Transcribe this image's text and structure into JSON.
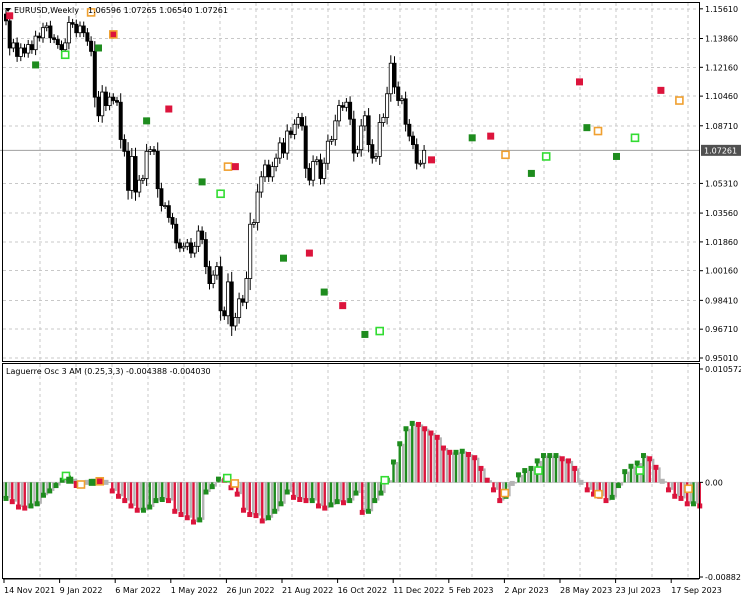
{
  "header": {
    "symbol_title": "EURUSD,Weekly",
    "ohlc": "1.06596 1.07265 1.06540 1.07261",
    "current_price_label": "1.07261"
  },
  "colors": {
    "bull_body": "#ffffff",
    "bear_body": "#000000",
    "bull_osc": "#1e8c1e",
    "bear_osc": "#dc143c",
    "neutral_osc": "#b4b4b4",
    "signal_green_fill": "#1e8c1e",
    "signal_red_fill": "#dc143c",
    "signal_lime_outline": "#32dc32",
    "signal_orange_outline": "#f0a030",
    "grid": "#c8c8c8",
    "price_line": "#a0a0a0"
  },
  "chart_data": [
    {
      "type": "candlestick",
      "title": "EURUSD,Weekly",
      "ylim": [
        0.9501,
        1.156
      ],
      "y_ticks": [
        "1.15610",
        "1.13860",
        "1.12160",
        "1.10460",
        "1.08710",
        "1.07261",
        "1.05310",
        "1.03560",
        "1.01860",
        "1.00160",
        "0.98410",
        "0.96710",
        "0.95010"
      ],
      "x_tick_labels": [
        "14 Nov 2021",
        "9 Jan 2022",
        "6 Mar 2022",
        "1 May 2022",
        "26 Jun 2022",
        "21 Aug 2022",
        "16 Oct 2022",
        "11 Dec 2022",
        "5 Feb 2023",
        "2 Apr 2023",
        "28 May 2023",
        "23 Jul 2023",
        "17 Sep 2023"
      ],
      "candle_closes": [
        1.149,
        1.133,
        1.136,
        1.128,
        1.133,
        1.13,
        1.135,
        1.132,
        1.14,
        1.139,
        1.145,
        1.146,
        1.139,
        1.138,
        1.135,
        1.132,
        1.136,
        1.148,
        1.147,
        1.142,
        1.146,
        1.142,
        1.137,
        1.131,
        1.104,
        1.093,
        1.107,
        1.099,
        1.104,
        1.102,
        1.101,
        1.079,
        1.072,
        1.049,
        1.069,
        1.048,
        1.055,
        1.056,
        1.072,
        1.073,
        1.072,
        1.05,
        1.04,
        1.04,
        1.033,
        1.029,
        1.018,
        1.015,
        1.016,
        1.018,
        1.012,
        1.016,
        1.025,
        1.02,
        1.004,
        0.994,
        0.999,
        1.004,
        0.978,
        0.975,
        0.995,
        0.969,
        0.974,
        0.985,
        0.983,
        0.997,
        1.029,
        1.03,
        1.048,
        1.057,
        1.064,
        1.057,
        1.063,
        1.068,
        1.077,
        1.071,
        1.084,
        1.082,
        1.088,
        1.092,
        1.087,
        1.062,
        1.055,
        1.066,
        1.067,
        1.056,
        1.065,
        1.078,
        1.079,
        1.09,
        1.099,
        1.098,
        1.101,
        1.091,
        1.071,
        1.073,
        1.087,
        1.093,
        1.076,
        1.068,
        1.069,
        1.089,
        1.092,
        1.106,
        1.124,
        1.11,
        1.102,
        1.103,
        1.088,
        1.081,
        1.076,
        1.065,
        1.065,
        1.07261
      ],
      "signal_markers": [
        {
          "pane": "price",
          "kind": "red_square",
          "index": 1,
          "value": 1.152
        },
        {
          "pane": "price",
          "kind": "green_square",
          "index": 8,
          "value": 1.123
        },
        {
          "pane": "price",
          "kind": "lime_outline",
          "index": 16,
          "value": 1.129
        },
        {
          "pane": "price",
          "kind": "orange_outline",
          "index": 23,
          "value": 1.154
        },
        {
          "pane": "price",
          "kind": "green_square",
          "index": 25,
          "value": 1.133
        },
        {
          "pane": "price",
          "kind": "orange_filled",
          "index": 29,
          "value": 1.141
        },
        {
          "pane": "price",
          "kind": "green_square",
          "index": 38,
          "value": 1.09
        },
        {
          "pane": "price",
          "kind": "red_square",
          "index": 44,
          "value": 1.097
        },
        {
          "pane": "price",
          "kind": "green_square",
          "index": 53,
          "value": 1.054
        },
        {
          "pane": "price",
          "kind": "lime_outline",
          "index": 58,
          "value": 1.047
        },
        {
          "pane": "price",
          "kind": "orange_outline",
          "index": 60,
          "value": 1.063
        },
        {
          "pane": "price",
          "kind": "red_square",
          "index": 62,
          "value": 1.063
        },
        {
          "pane": "price",
          "kind": "green_square",
          "index": 75,
          "value": 1.009
        },
        {
          "pane": "price",
          "kind": "red_square",
          "index": 82,
          "value": 1.012
        },
        {
          "pane": "price",
          "kind": "green_square",
          "index": 86,
          "value": 0.989
        },
        {
          "pane": "price",
          "kind": "red_square",
          "index": 91,
          "value": 0.981
        },
        {
          "pane": "price",
          "kind": "green_square",
          "index": 97,
          "value": 0.964
        },
        {
          "pane": "price",
          "kind": "lime_outline",
          "index": 101,
          "value": 0.966
        },
        {
          "pane": "price",
          "kind": "red_square",
          "index": 115,
          "value": 1.067
        },
        {
          "pane": "price",
          "kind": "green_square",
          "index": 126,
          "value": 1.08
        },
        {
          "pane": "price",
          "kind": "red_square",
          "index": 131,
          "value": 1.081
        },
        {
          "pane": "price",
          "kind": "orange_outline",
          "index": 135,
          "value": 1.07
        },
        {
          "pane": "price",
          "kind": "green_square",
          "index": 142,
          "value": 1.059
        },
        {
          "pane": "price",
          "kind": "lime_outline",
          "index": 146,
          "value": 1.069
        },
        {
          "pane": "price",
          "kind": "red_square",
          "index": 155,
          "value": 1.113
        },
        {
          "pane": "price",
          "kind": "green_square",
          "index": 157,
          "value": 1.086
        },
        {
          "pane": "price",
          "kind": "orange_outline",
          "index": 160,
          "value": 1.084
        },
        {
          "pane": "price",
          "kind": "green_square",
          "index": 165,
          "value": 1.069
        },
        {
          "pane": "price",
          "kind": "lime_outline",
          "index": 170,
          "value": 1.08
        },
        {
          "pane": "price",
          "kind": "red_square",
          "index": 177,
          "value": 1.108
        },
        {
          "pane": "price",
          "kind": "orange_outline",
          "index": 182,
          "value": 1.102
        }
      ]
    },
    {
      "type": "bar",
      "title": "Laguerre Osc 3 AM (0.25,3,3) -0.004388 -0.004030",
      "ylim": [
        -0.008827,
        0.010572
      ],
      "y_ticks": [
        "0.010572",
        "0.00",
        "-0.008827"
      ],
      "values": [
        -0.0015,
        -0.0018,
        -0.0023,
        -0.0024,
        -0.0022,
        -0.002,
        -0.0012,
        -0.0008,
        -0.0003,
        0.0002,
        0.0004,
        0.0001,
        -0.0002,
        0.0,
        0.0001,
        0.0001,
        0.0,
        -0.0008,
        -0.0013,
        -0.0017,
        -0.0022,
        -0.0026,
        -0.0026,
        -0.0023,
        -0.0017,
        -0.0016,
        -0.0017,
        -0.0027,
        -0.003,
        -0.0033,
        -0.0037,
        -0.0035,
        -0.0009,
        -0.0004,
        0.0003,
        0.0002,
        -0.0005,
        -0.0011,
        -0.0026,
        -0.003,
        -0.0031,
        -0.0036,
        -0.0033,
        -0.0027,
        -0.002,
        -0.0009,
        -0.0014,
        -0.0016,
        -0.0017,
        -0.0017,
        -0.0022,
        -0.0024,
        -0.0021,
        -0.0018,
        -0.0019,
        -0.0017,
        -0.001,
        -0.0028,
        -0.0027,
        -0.0017,
        -0.001,
        0.0002,
        0.0019,
        0.0036,
        0.005,
        0.0055,
        0.0054,
        0.005,
        0.0046,
        0.0042,
        0.0032,
        0.0028,
        0.0028,
        0.0029,
        0.0026,
        0.0023,
        0.0013,
        0.0002,
        -0.0007,
        -0.0017,
        -0.0013,
        -0.0001,
        0.0007,
        0.0011,
        0.0013,
        0.002,
        0.0025,
        0.0025,
        0.0025,
        0.0022,
        0.002,
        0.0013,
        0.0,
        -0.0007,
        -0.0011,
        -0.0013,
        -0.0017,
        -0.0014,
        -0.0003,
        0.001,
        0.0015,
        0.0018,
        0.0025,
        0.0022,
        0.0014,
        0.0001,
        -0.0007,
        -0.0013,
        -0.0015,
        -0.002,
        -0.002,
        -0.0022
      ],
      "signal_markers": [
        {
          "pane": "osc",
          "kind": "lime_outline",
          "index": 16,
          "value": 0.0006
        },
        {
          "pane": "osc",
          "kind": "green_square",
          "index": 17,
          "value": 0.0002
        },
        {
          "pane": "osc",
          "kind": "red_square",
          "index": 19,
          "value": -0.0002
        },
        {
          "pane": "osc",
          "kind": "orange_outline",
          "index": 20,
          "value": -0.0002
        },
        {
          "pane": "osc",
          "kind": "green_square",
          "index": 23,
          "value": 0.0
        },
        {
          "pane": "osc",
          "kind": "orange_filled",
          "index": 25,
          "value": 0.0001
        },
        {
          "pane": "osc",
          "kind": "lime_outline",
          "index": 59,
          "value": 0.0004
        },
        {
          "pane": "osc",
          "kind": "orange_outline",
          "index": 61,
          "value": -0.0001
        },
        {
          "pane": "osc",
          "kind": "lime_outline",
          "index": 101,
          "value": 0.0002
        },
        {
          "pane": "osc",
          "kind": "orange_outline",
          "index": 133,
          "value": -0.001
        },
        {
          "pane": "osc",
          "kind": "lime_outline",
          "index": 142,
          "value": 0.0011
        },
        {
          "pane": "osc",
          "kind": "orange_outline",
          "index": 158,
          "value": -0.0011
        },
        {
          "pane": "osc",
          "kind": "lime_outline",
          "index": 169,
          "value": 0.0011
        },
        {
          "pane": "osc",
          "kind": "orange_outline",
          "index": 182,
          "value": -0.0006
        }
      ]
    }
  ]
}
